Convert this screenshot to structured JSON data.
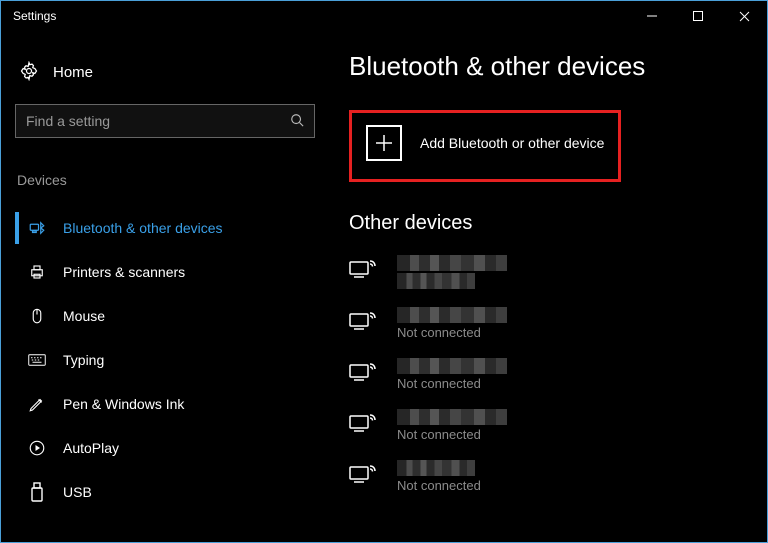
{
  "window": {
    "title": "Settings"
  },
  "home": {
    "label": "Home"
  },
  "search": {
    "placeholder": "Find a setting"
  },
  "sidebar": {
    "heading": "Devices",
    "items": [
      {
        "label": "Bluetooth & other devices"
      },
      {
        "label": "Printers & scanners"
      },
      {
        "label": "Mouse"
      },
      {
        "label": "Typing"
      },
      {
        "label": "Pen & Windows Ink"
      },
      {
        "label": "AutoPlay"
      },
      {
        "label": "USB"
      }
    ]
  },
  "page": {
    "title": "Bluetooth & other devices",
    "add_label": "Add Bluetooth or other device",
    "other_heading": "Other devices"
  },
  "devices": [
    {
      "status": ""
    },
    {
      "status": "Not connected"
    },
    {
      "status": "Not connected"
    },
    {
      "status": "Not connected"
    },
    {
      "status": "Not connected"
    }
  ],
  "colors": {
    "accent": "#3aa0e8",
    "highlight_border": "#e62121"
  }
}
